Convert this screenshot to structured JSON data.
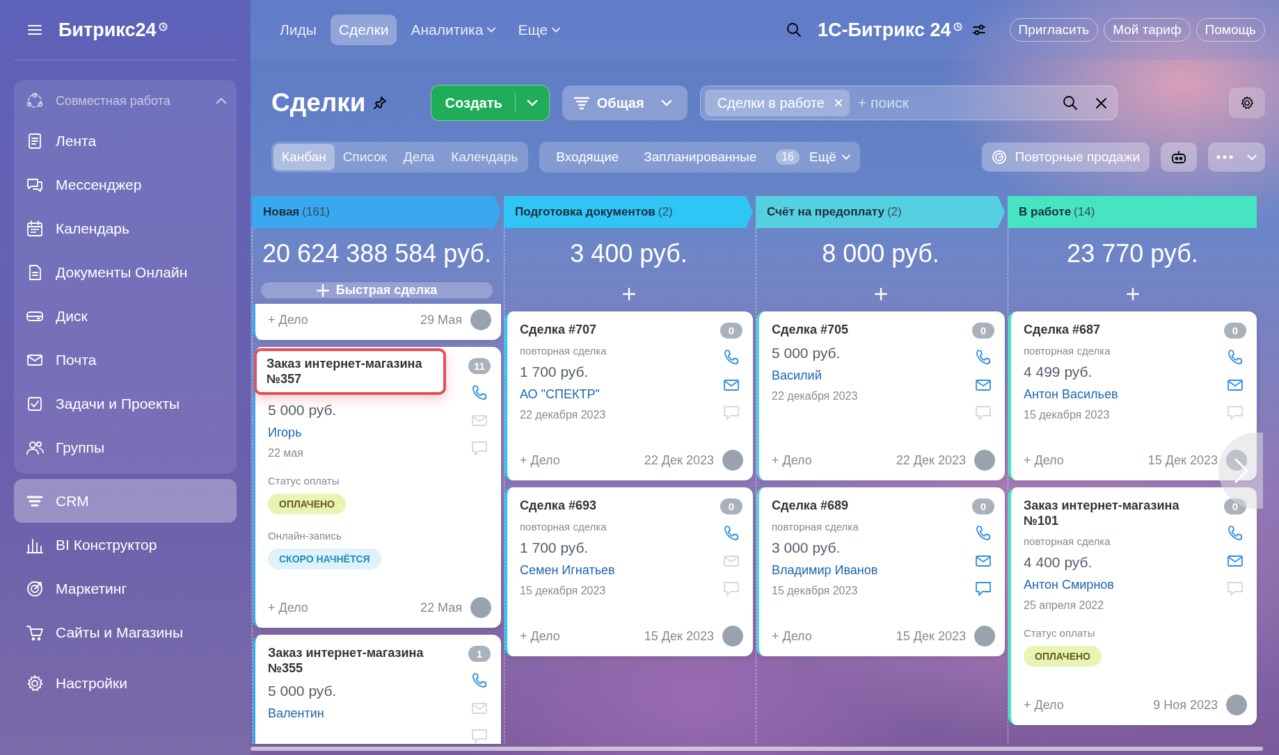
{
  "sidebar": {
    "logo": "Битрикс24",
    "group": {
      "title": "Совместная работа",
      "expanded": true,
      "items": [
        {
          "label": "Лента",
          "selected": false
        },
        {
          "label": "Мессенджер",
          "selected": false
        },
        {
          "label": "Календарь",
          "selected": false
        },
        {
          "label": "Документы Онлайн",
          "selected": false
        },
        {
          "label": "Диск",
          "selected": false
        },
        {
          "label": "Почта",
          "selected": false
        },
        {
          "label": "Задачи и Проекты",
          "selected": false
        },
        {
          "label": "Группы",
          "selected": false
        }
      ]
    },
    "items": [
      {
        "label": "CRM",
        "selected": true
      },
      {
        "label": "BI Конструктор",
        "selected": false
      },
      {
        "label": "Маркетинг",
        "selected": false
      },
      {
        "label": "Сайты и Магазины",
        "selected": false
      },
      {
        "label": "Настройки",
        "selected": false
      }
    ]
  },
  "top_nav": {
    "tabs": [
      {
        "label": "Лиды",
        "selected": false,
        "dropdown": false
      },
      {
        "label": "Сделки",
        "selected": true,
        "dropdown": false
      },
      {
        "label": "Аналитика",
        "selected": false,
        "dropdown": true
      },
      {
        "label": "Еще",
        "selected": false,
        "dropdown": true
      }
    ],
    "brand": "1С-Битрикс 24",
    "buttons": [
      "Пригласить",
      "Мой тариф",
      "Помощь"
    ]
  },
  "toolbar": {
    "title": "Сделки",
    "create_button": "Создать",
    "category_button": "Общая",
    "search": {
      "tags": [
        "Сделки в работе"
      ],
      "placeholder": "+ поиск"
    }
  },
  "views": {
    "tabs": [
      {
        "label": "Канбан",
        "selected": true
      },
      {
        "label": "Список",
        "selected": false
      },
      {
        "label": "Дела",
        "selected": false
      },
      {
        "label": "Календарь",
        "selected": false
      }
    ],
    "filters": [
      {
        "label": "Входящие"
      },
      {
        "label": "Запланированные",
        "count": "16"
      }
    ],
    "more": "Ещё",
    "repeat_sales": "Повторные продажи"
  },
  "columns": [
    {
      "title": "Новая",
      "count": "(161)",
      "color": "#39a8ef",
      "sum": "20 624 388 584 руб.",
      "quick_deal": "Быстрая сделка",
      "cards": [
        {
          "add_activity": "+ Дело",
          "due": "29 Мая"
        },
        {
          "title": "Заказ интернет-магазина №357",
          "highlighted": true,
          "counter": "11",
          "amount": "5 000 руб.",
          "contact": "Игорь",
          "date": "22 мая",
          "email_active": false,
          "chat_active": false,
          "fields": [
            {
              "label": "Статус оплаты",
              "value": "ОПЛАЧЕНО",
              "kind": "paid"
            },
            {
              "label": "Онлайн-запись",
              "value": "СКОРО НАЧНЁТСЯ",
              "kind": "soon"
            }
          ],
          "add_activity": "+ Дело",
          "due": "22 Мая"
        },
        {
          "title": "Заказ интернет-магазина №355",
          "highlighted": false,
          "counter": "1",
          "amount": "5 000 руб.",
          "contact": "Валентин",
          "email_active": false,
          "chat_active": false
        }
      ]
    },
    {
      "title": "Подготовка документов",
      "count": "(2)",
      "color": "#2fc6f6",
      "sum": "3 400 руб.",
      "cards": [
        {
          "title": "Сделка #707",
          "highlighted": false,
          "counter": "0",
          "subtitle": "повторная сделка",
          "amount": "1 700 руб.",
          "contact": "АО \"СПЕКТР\"",
          "date": "22 декабря 2023",
          "email_active": true,
          "chat_active": false,
          "add_activity": "+ Дело",
          "due": "22 Дек 2023"
        },
        {
          "title": "Сделка #693",
          "highlighted": false,
          "counter": "0",
          "subtitle": "повторная сделка",
          "amount": "1 700 руб.",
          "contact": "Семен Игнатьев",
          "date": "15 декабря 2023",
          "email_active": false,
          "chat_active": false,
          "add_activity": "+ Дело",
          "due": "15 Дек 2023"
        }
      ]
    },
    {
      "title": "Счёт на предоплату",
      "count": "(2)",
      "color": "#55d0e0",
      "sum": "8 000 руб.",
      "cards": [
        {
          "title": "Сделка #705",
          "highlighted": false,
          "counter": "0",
          "amount": "5 000 руб.",
          "contact": "Василий",
          "date": "22 декабря 2023",
          "email_active": true,
          "chat_active": false,
          "add_activity": "+ Дело",
          "due": "22 Дек 2023"
        },
        {
          "title": "Сделка #689",
          "highlighted": false,
          "counter": "0",
          "subtitle": "повторная сделка",
          "amount": "3 000 руб.",
          "contact": "Владимир Иванов",
          "date": "15 декабря 2023",
          "email_active": true,
          "chat_active": true,
          "add_activity": "+ Дело",
          "due": "15 Дек 2023"
        }
      ]
    },
    {
      "title": "В работе",
      "count": "(14)",
      "color": "#47e4c2",
      "sum": "23 770 руб.",
      "cards": [
        {
          "title": "Сделка #687",
          "highlighted": false,
          "counter": "0",
          "subtitle": "повторная сделка",
          "amount": "4 499 руб.",
          "contact": "Антон Васильев",
          "date": "15 декабря 2023",
          "email_active": true,
          "chat_active": false,
          "add_activity": "+ Дело",
          "due": "15 Дек 2023"
        },
        {
          "title": "Заказ интернет-магазина №101",
          "highlighted": false,
          "counter": "0",
          "subtitle": "повторная сделка",
          "amount": "4 400 руб.",
          "contact": "Антон Смирнов",
          "date": "25 апреля 2022",
          "email_active": true,
          "chat_active": false,
          "fields": [
            {
              "label": "Статус оплаты",
              "value": "ОПЛАЧЕНО",
              "kind": "paid"
            }
          ],
          "add_activity": "+ Дело",
          "due": "9 Ноя 2023"
        }
      ]
    }
  ]
}
